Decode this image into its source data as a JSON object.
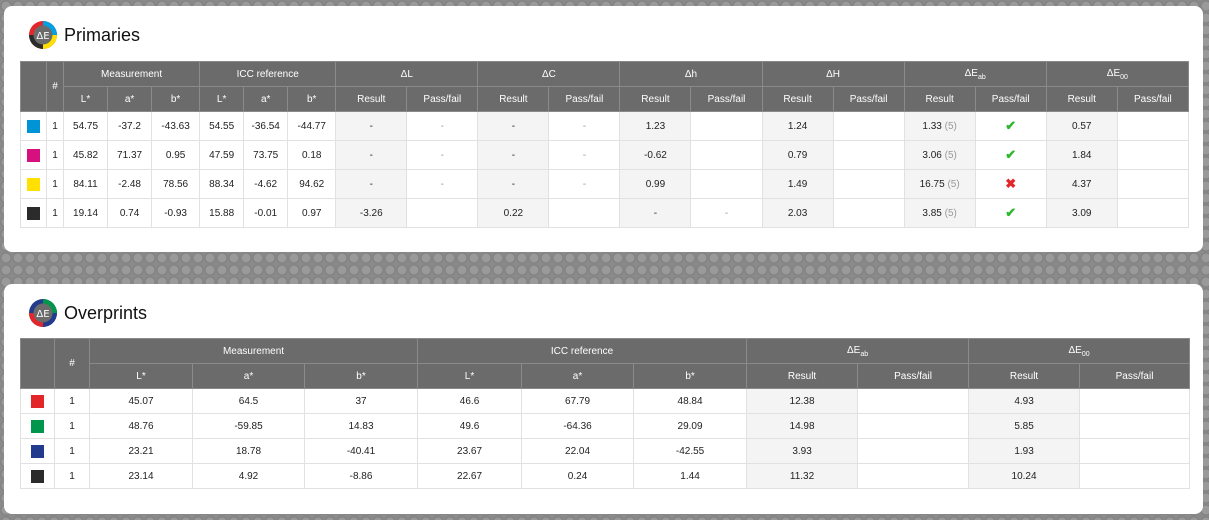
{
  "colors": {
    "header_bg": "#6b6b6b",
    "pass": "#2db82d",
    "fail": "#e3262a"
  },
  "primaries": {
    "title": "Primaries",
    "logo": "ΔE",
    "headers": {
      "num": "#",
      "measurement": "Measurement",
      "icc": "ICC reference",
      "dL": "ΔL",
      "dC": "ΔC",
      "dh": "Δh",
      "dH": "ΔH",
      "dEab": "ΔE",
      "dEab_sub": "ab",
      "dE00": "ΔE",
      "dE00_sub": "00",
      "L": "L*",
      "a": "a*",
      "b": "b*",
      "result": "Result",
      "passfail": "Pass/fail"
    },
    "rows": [
      {
        "swatch": "#0093d5",
        "n": "1",
        "mL": "54.75",
        "ma": "-37.2",
        "mb": "-43.63",
        "rL": "54.55",
        "ra": "-36.54",
        "rb": "-44.77",
        "dL": "-",
        "dLpf": "-",
        "dC": "-",
        "dCpf": "-",
        "dh": "1.23",
        "dhpf": "",
        "dH": "1.24",
        "dHpf": "",
        "dEab": "1.33",
        "dEab_tol": "(5)",
        "dEab_pf": "pass",
        "dE00": "0.57",
        "dE00pf": ""
      },
      {
        "swatch": "#d6117f",
        "n": "1",
        "mL": "45.82",
        "ma": "71.37",
        "mb": "0.95",
        "rL": "47.59",
        "ra": "73.75",
        "rb": "0.18",
        "dL": "-",
        "dLpf": "-",
        "dC": "-",
        "dCpf": "-",
        "dh": "-0.62",
        "dhpf": "",
        "dH": "0.79",
        "dHpf": "",
        "dEab": "3.06",
        "dEab_tol": "(5)",
        "dEab_pf": "pass",
        "dE00": "1.84",
        "dE00pf": ""
      },
      {
        "swatch": "#ffe000",
        "n": "1",
        "mL": "84.11",
        "ma": "-2.48",
        "mb": "78.56",
        "rL": "88.34",
        "ra": "-4.62",
        "rb": "94.62",
        "dL": "-",
        "dLpf": "-",
        "dC": "-",
        "dCpf": "-",
        "dh": "0.99",
        "dhpf": "",
        "dH": "1.49",
        "dHpf": "",
        "dEab": "16.75",
        "dEab_tol": "(5)",
        "dEab_pf": "fail",
        "dE00": "4.37",
        "dE00pf": ""
      },
      {
        "swatch": "#2b2b2b",
        "n": "1",
        "mL": "19.14",
        "ma": "0.74",
        "mb": "-0.93",
        "rL": "15.88",
        "ra": "-0.01",
        "rb": "0.97",
        "dL": "-3.26",
        "dLpf": "",
        "dC": "0.22",
        "dCpf": "",
        "dh": "-",
        "dhpf": "-",
        "dH": "2.03",
        "dHpf": "",
        "dEab": "3.85",
        "dEab_tol": "(5)",
        "dEab_pf": "pass",
        "dE00": "3.09",
        "dE00pf": ""
      }
    ]
  },
  "overprints": {
    "title": "Overprints",
    "logo": "ΔE",
    "headers": {
      "num": "#",
      "measurement": "Measurement",
      "icc": "ICC reference",
      "dEab": "ΔE",
      "dEab_sub": "ab",
      "dE00": "ΔE",
      "dE00_sub": "00",
      "L": "L*",
      "a": "a*",
      "b": "b*",
      "result": "Result",
      "passfail": "Pass/fail"
    },
    "rows": [
      {
        "swatch": "#e3262a",
        "n": "1",
        "mL": "45.07",
        "ma": "64.5",
        "mb": "37",
        "rL": "46.6",
        "ra": "67.79",
        "rb": "48.84",
        "dEab": "12.38",
        "dEab_pf": "",
        "dE00": "4.93",
        "dE00pf": ""
      },
      {
        "swatch": "#00964b",
        "n": "1",
        "mL": "48.76",
        "ma": "-59.85",
        "mb": "14.83",
        "rL": "49.6",
        "ra": "-64.36",
        "rb": "29.09",
        "dEab": "14.98",
        "dEab_pf": "",
        "dE00": "5.85",
        "dE00pf": ""
      },
      {
        "swatch": "#233b8c",
        "n": "1",
        "mL": "23.21",
        "ma": "18.78",
        "mb": "-40.41",
        "rL": "23.67",
        "ra": "22.04",
        "rb": "-42.55",
        "dEab": "3.93",
        "dEab_pf": "",
        "dE00": "1.93",
        "dE00pf": ""
      },
      {
        "swatch": "#2b2b2b",
        "n": "1",
        "mL": "23.14",
        "ma": "4.92",
        "mb": "-8.86",
        "rL": "22.67",
        "ra": "0.24",
        "rb": "1.44",
        "dEab": "11.32",
        "dEab_pf": "",
        "dE00": "10.24",
        "dE00pf": ""
      }
    ]
  }
}
